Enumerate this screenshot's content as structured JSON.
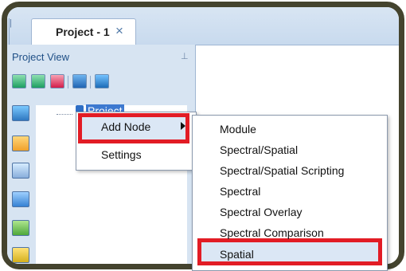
{
  "tab": {
    "label": "Project - 1",
    "close_icon": "×",
    "left_stub_icon": "|"
  },
  "panel": {
    "title": "Project View",
    "pin_icon": "⊥"
  },
  "tree": {
    "node_label": "Project"
  },
  "context_menu": {
    "items": [
      {
        "label": "Add Node"
      },
      {
        "label": "Settings"
      }
    ]
  },
  "submenu": {
    "items": [
      {
        "label": "Module"
      },
      {
        "label": "Spectral/Spatial"
      },
      {
        "label": "Spectral/Spatial Scripting"
      },
      {
        "label": "Spectral"
      },
      {
        "label": "Spectral Overlay"
      },
      {
        "label": "Spectral Comparison"
      },
      {
        "label": "Spatial"
      }
    ]
  },
  "colors": {
    "frame_border": "#44432e",
    "highlight_border": "#e21c25",
    "panel_bg": "#d7e4f2",
    "selection_bg": "#dbe7f5"
  }
}
